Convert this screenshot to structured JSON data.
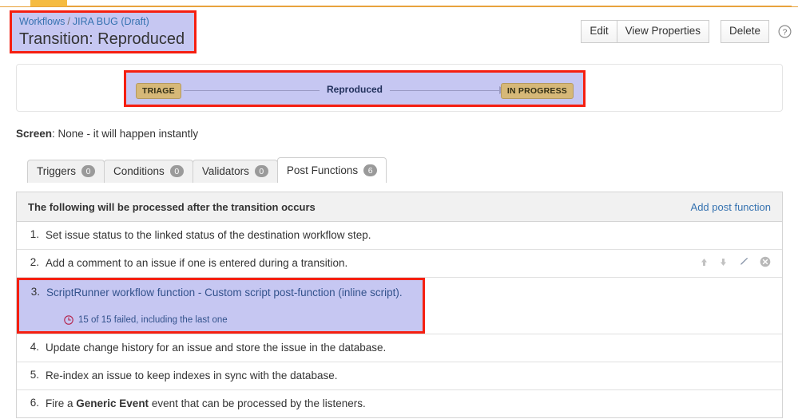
{
  "topbar": {
    "tab_label": ""
  },
  "header": {
    "breadcrumb": {
      "root_label": "Workflows",
      "separator": "/",
      "current_label": "JIRA BUG (Draft)"
    },
    "page_title": "Transition: Reproduced",
    "actions": {
      "edit_label": "Edit",
      "view_properties_label": "View Properties",
      "delete_label": "Delete",
      "help_icon": "help-circle-icon"
    }
  },
  "diagram": {
    "source_status": "TRIAGE",
    "transition_label": "Reproduced",
    "target_status": "IN PROGRESS",
    "arrow_icon": "arrow-right-icon"
  },
  "screen": {
    "label": "Screen",
    "value": ": None - it will happen instantly"
  },
  "tabs": [
    {
      "label": "Triggers",
      "count": "0",
      "active": false
    },
    {
      "label": "Conditions",
      "count": "0",
      "active": false
    },
    {
      "label": "Validators",
      "count": "0",
      "active": false
    },
    {
      "label": "Post Functions",
      "count": "6",
      "active": true
    }
  ],
  "panel": {
    "heading": "The following will be processed after the transition occurs",
    "add_link": "Add post function",
    "rows": [
      {
        "number": "1.",
        "text": "Set issue status to the linked status of the destination workflow step."
      },
      {
        "number": "2.",
        "text": "Add a comment to an issue if one is entered during a transition."
      },
      {
        "number": "3.",
        "text": "ScriptRunner workflow function - Custom script post-function (inline script).",
        "status_text": "15 of 15 failed, including the last one",
        "status_icon": "clock-icon"
      },
      {
        "number": "4.",
        "text": "Update change history for an issue and store the issue in the database."
      },
      {
        "number": "5.",
        "text": "Re-index an issue to keep indexes in sync with the database."
      },
      {
        "number": "6.",
        "text_before": "Fire a ",
        "text_bold": "Generic Event",
        "text_after": " event that can be processed by the listeners."
      }
    ],
    "row_icons": {
      "move_up": "arrow-up-icon",
      "move_down": "arrow-down-icon",
      "edit": "pencil-icon",
      "delete": "close-circle-icon"
    }
  },
  "colors": {
    "highlight_fill": "#c6c7f2",
    "highlight_border": "#f51f11",
    "link": "#3572b0",
    "status_chip": "#d6b878",
    "banner": "#f5bb41"
  }
}
